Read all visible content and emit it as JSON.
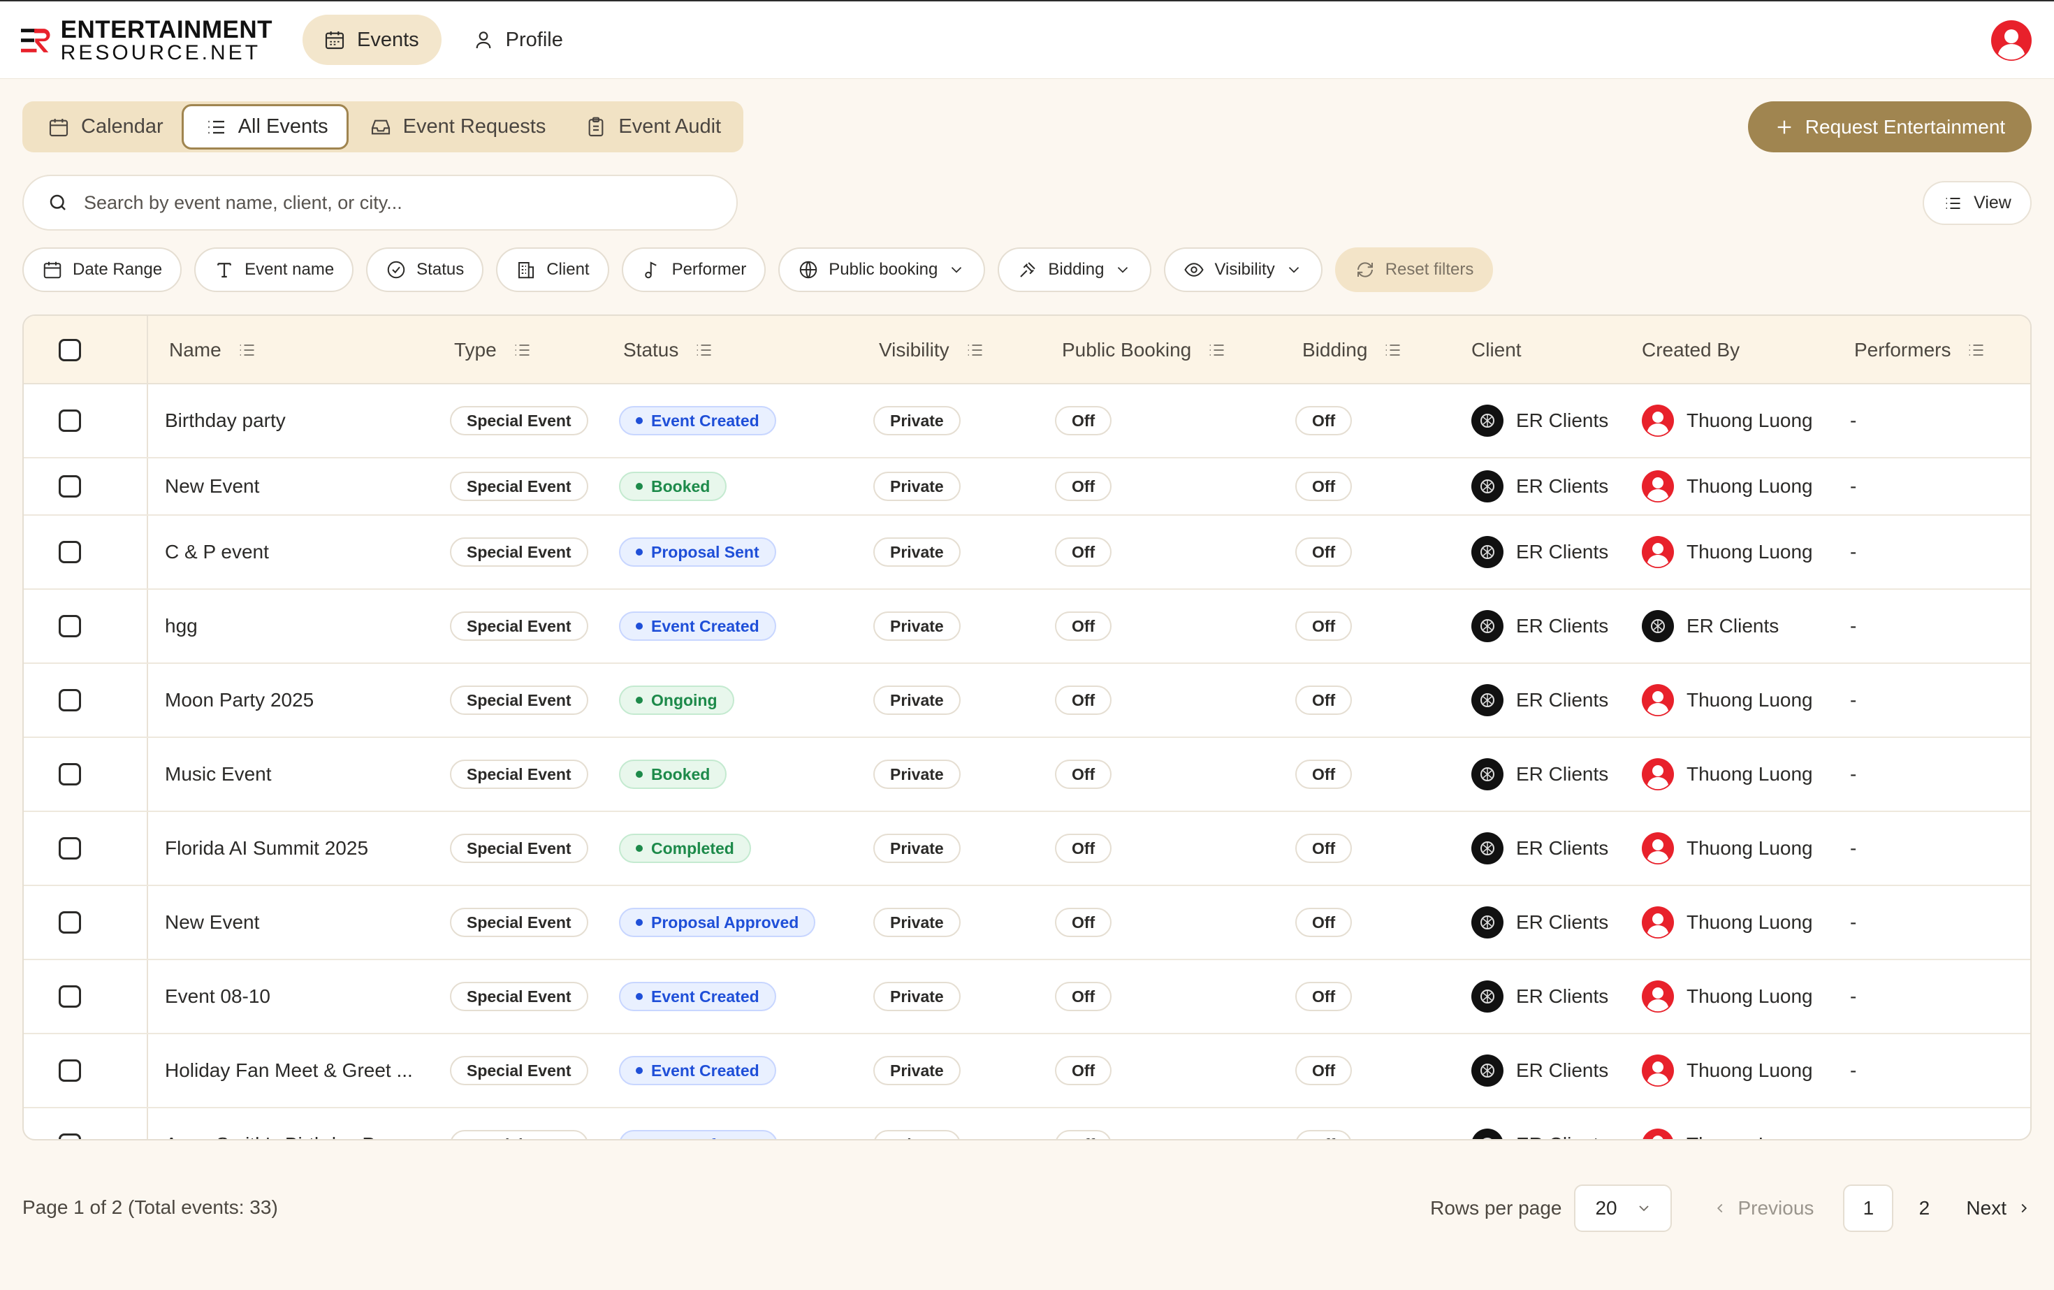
{
  "brand": {
    "line1": "ENTERTAINMENT",
    "line2": "RESOURCE.NET"
  },
  "nav": [
    {
      "label": "Events",
      "icon": "calendar-icon",
      "active": true
    },
    {
      "label": "Profile",
      "icon": "user-icon",
      "active": false
    }
  ],
  "tabs": [
    {
      "label": "Calendar",
      "icon": "calendar-icon"
    },
    {
      "label": "All Events",
      "icon": "list-icon",
      "active": true
    },
    {
      "label": "Event Requests",
      "icon": "inbox-icon"
    },
    {
      "label": "Event Audit",
      "icon": "clipboard-icon"
    }
  ],
  "request_button": "Request Entertainment",
  "search": {
    "placeholder": "Search by event name, client, or city..."
  },
  "view_button": "View",
  "filters": [
    {
      "label": "Date Range",
      "icon": "calendar-icon"
    },
    {
      "label": "Event name",
      "icon": "text-icon"
    },
    {
      "label": "Status",
      "icon": "check-circle-icon"
    },
    {
      "label": "Client",
      "icon": "building-icon"
    },
    {
      "label": "Performer",
      "icon": "music-note-icon"
    },
    {
      "label": "Public booking",
      "icon": "globe-icon",
      "dropdown": true
    },
    {
      "label": "Bidding",
      "icon": "gavel-icon",
      "dropdown": true
    },
    {
      "label": "Visibility",
      "icon": "eye-icon",
      "dropdown": true
    },
    {
      "label": "Reset filters",
      "icon": "refresh-icon"
    }
  ],
  "columns": [
    "Name",
    "Type",
    "Status",
    "Visibility",
    "Public Booking",
    "Bidding",
    "Client",
    "Created By",
    "Performers"
  ],
  "rows": [
    {
      "name": "Birthday party",
      "type": "Special Event",
      "status": "Event Created",
      "status_color": "blue",
      "visibility": "Private",
      "public_booking": "Off",
      "bidding": "Off",
      "client": "ER Clients",
      "created_by": "Thuong Luong",
      "created_by_avatar": "user",
      "performers": "-"
    },
    {
      "name": "New Event",
      "type": "Special Event",
      "status": "Booked",
      "status_color": "green",
      "visibility": "Private",
      "public_booking": "Off",
      "bidding": "Off",
      "client": "ER Clients",
      "created_by": "Thuong Luong",
      "created_by_avatar": "user",
      "performers": "-"
    },
    {
      "name": "C & P event",
      "type": "Special Event",
      "status": "Proposal Sent",
      "status_color": "blue",
      "visibility": "Private",
      "public_booking": "Off",
      "bidding": "Off",
      "client": "ER Clients",
      "created_by": "Thuong Luong",
      "created_by_avatar": "user",
      "performers": "-"
    },
    {
      "name": "hgg",
      "type": "Special Event",
      "status": "Event Created",
      "status_color": "blue",
      "visibility": "Private",
      "public_booking": "Off",
      "bidding": "Off",
      "client": "ER Clients",
      "created_by": "ER Clients",
      "created_by_avatar": "client",
      "performers": "-"
    },
    {
      "name": "Moon Party 2025",
      "type": "Special Event",
      "status": "Ongoing",
      "status_color": "green",
      "visibility": "Private",
      "public_booking": "Off",
      "bidding": "Off",
      "client": "ER Clients",
      "created_by": "Thuong Luong",
      "created_by_avatar": "user",
      "performers": "-"
    },
    {
      "name": "Music Event",
      "type": "Special Event",
      "status": "Booked",
      "status_color": "green",
      "visibility": "Private",
      "public_booking": "Off",
      "bidding": "Off",
      "client": "ER Clients",
      "created_by": "Thuong Luong",
      "created_by_avatar": "user",
      "performers": "-"
    },
    {
      "name": "Florida AI Summit 2025",
      "type": "Special Event",
      "status": "Completed",
      "status_color": "green",
      "visibility": "Private",
      "public_booking": "Off",
      "bidding": "Off",
      "client": "ER Clients",
      "created_by": "Thuong Luong",
      "created_by_avatar": "user",
      "performers": "-"
    },
    {
      "name": "New Event",
      "type": "Special Event",
      "status": "Proposal Approved",
      "status_color": "blue",
      "visibility": "Private",
      "public_booking": "Off",
      "bidding": "Off",
      "client": "ER Clients",
      "created_by": "Thuong Luong",
      "created_by_avatar": "user",
      "performers": "-"
    },
    {
      "name": "Event 08-10",
      "type": "Special Event",
      "status": "Event Created",
      "status_color": "blue",
      "visibility": "Private",
      "public_booking": "Off",
      "bidding": "Off",
      "client": "ER Clients",
      "created_by": "Thuong Luong",
      "created_by_avatar": "user",
      "performers": "-"
    },
    {
      "name": "Holiday Fan Meet & Greet ...",
      "type": "Special Event",
      "status": "Event Created",
      "status_color": "blue",
      "visibility": "Private",
      "public_booking": "Off",
      "bidding": "Off",
      "client": "ER Clients",
      "created_by": "Thuong Luong",
      "created_by_avatar": "user",
      "performers": "-"
    },
    {
      "name": "Anna Smith's Birthday Par...",
      "type": "Special Event",
      "status": "Pay Performer",
      "status_color": "blue",
      "visibility": "Private",
      "public_booking": "Off",
      "bidding": "Off",
      "client": "ER Clients",
      "created_by": "Thuong Luong",
      "created_by_avatar": "user",
      "performers": "-"
    }
  ],
  "footer": {
    "summary": "Page 1 of 2 (Total events: 33)",
    "rows_per_page_label": "Rows per page",
    "rows_per_page_value": "20",
    "previous": "Previous",
    "pages": [
      "1",
      "2"
    ],
    "current_page": "1",
    "next": "Next"
  },
  "colors": {
    "accent": "#a08550",
    "tab_bg": "#f1e2c4",
    "page_bg": "#fcf7f0",
    "brand_red": "#e8212b"
  }
}
